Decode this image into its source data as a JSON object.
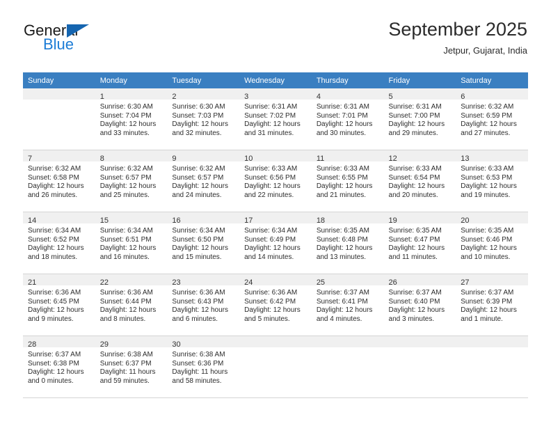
{
  "brand": {
    "word1": "General",
    "word2": "Blue",
    "triangle_color": "#1565b0",
    "blue_text_color": "#1c7cd6"
  },
  "header": {
    "title": "September 2025",
    "subtitle": "Jetpur, Gujarat, India"
  },
  "theme": {
    "header_row_bg": "#3a7fc1",
    "header_row_text": "#ffffff",
    "daynum_band_bg": "#f0f0f0",
    "grid_line": "#d4d4d4"
  },
  "calendar": {
    "weekday_headers": [
      "Sunday",
      "Monday",
      "Tuesday",
      "Wednesday",
      "Thursday",
      "Friday",
      "Saturday"
    ],
    "weeks": [
      [
        {
          "day": "",
          "sunrise": "",
          "sunset": "",
          "daylight": "",
          "empty": true
        },
        {
          "day": "1",
          "sunrise": "Sunrise: 6:30 AM",
          "sunset": "Sunset: 7:04 PM",
          "daylight": "Daylight: 12 hours and 33 minutes."
        },
        {
          "day": "2",
          "sunrise": "Sunrise: 6:30 AM",
          "sunset": "Sunset: 7:03 PM",
          "daylight": "Daylight: 12 hours and 32 minutes."
        },
        {
          "day": "3",
          "sunrise": "Sunrise: 6:31 AM",
          "sunset": "Sunset: 7:02 PM",
          "daylight": "Daylight: 12 hours and 31 minutes."
        },
        {
          "day": "4",
          "sunrise": "Sunrise: 6:31 AM",
          "sunset": "Sunset: 7:01 PM",
          "daylight": "Daylight: 12 hours and 30 minutes."
        },
        {
          "day": "5",
          "sunrise": "Sunrise: 6:31 AM",
          "sunset": "Sunset: 7:00 PM",
          "daylight": "Daylight: 12 hours and 29 minutes."
        },
        {
          "day": "6",
          "sunrise": "Sunrise: 6:32 AM",
          "sunset": "Sunset: 6:59 PM",
          "daylight": "Daylight: 12 hours and 27 minutes."
        }
      ],
      [
        {
          "day": "7",
          "sunrise": "Sunrise: 6:32 AM",
          "sunset": "Sunset: 6:58 PM",
          "daylight": "Daylight: 12 hours and 26 minutes."
        },
        {
          "day": "8",
          "sunrise": "Sunrise: 6:32 AM",
          "sunset": "Sunset: 6:57 PM",
          "daylight": "Daylight: 12 hours and 25 minutes."
        },
        {
          "day": "9",
          "sunrise": "Sunrise: 6:32 AM",
          "sunset": "Sunset: 6:57 PM",
          "daylight": "Daylight: 12 hours and 24 minutes."
        },
        {
          "day": "10",
          "sunrise": "Sunrise: 6:33 AM",
          "sunset": "Sunset: 6:56 PM",
          "daylight": "Daylight: 12 hours and 22 minutes."
        },
        {
          "day": "11",
          "sunrise": "Sunrise: 6:33 AM",
          "sunset": "Sunset: 6:55 PM",
          "daylight": "Daylight: 12 hours and 21 minutes."
        },
        {
          "day": "12",
          "sunrise": "Sunrise: 6:33 AM",
          "sunset": "Sunset: 6:54 PM",
          "daylight": "Daylight: 12 hours and 20 minutes."
        },
        {
          "day": "13",
          "sunrise": "Sunrise: 6:33 AM",
          "sunset": "Sunset: 6:53 PM",
          "daylight": "Daylight: 12 hours and 19 minutes."
        }
      ],
      [
        {
          "day": "14",
          "sunrise": "Sunrise: 6:34 AM",
          "sunset": "Sunset: 6:52 PM",
          "daylight": "Daylight: 12 hours and 18 minutes."
        },
        {
          "day": "15",
          "sunrise": "Sunrise: 6:34 AM",
          "sunset": "Sunset: 6:51 PM",
          "daylight": "Daylight: 12 hours and 16 minutes."
        },
        {
          "day": "16",
          "sunrise": "Sunrise: 6:34 AM",
          "sunset": "Sunset: 6:50 PM",
          "daylight": "Daylight: 12 hours and 15 minutes."
        },
        {
          "day": "17",
          "sunrise": "Sunrise: 6:34 AM",
          "sunset": "Sunset: 6:49 PM",
          "daylight": "Daylight: 12 hours and 14 minutes."
        },
        {
          "day": "18",
          "sunrise": "Sunrise: 6:35 AM",
          "sunset": "Sunset: 6:48 PM",
          "daylight": "Daylight: 12 hours and 13 minutes."
        },
        {
          "day": "19",
          "sunrise": "Sunrise: 6:35 AM",
          "sunset": "Sunset: 6:47 PM",
          "daylight": "Daylight: 12 hours and 11 minutes."
        },
        {
          "day": "20",
          "sunrise": "Sunrise: 6:35 AM",
          "sunset": "Sunset: 6:46 PM",
          "daylight": "Daylight: 12 hours and 10 minutes."
        }
      ],
      [
        {
          "day": "21",
          "sunrise": "Sunrise: 6:36 AM",
          "sunset": "Sunset: 6:45 PM",
          "daylight": "Daylight: 12 hours and 9 minutes."
        },
        {
          "day": "22",
          "sunrise": "Sunrise: 6:36 AM",
          "sunset": "Sunset: 6:44 PM",
          "daylight": "Daylight: 12 hours and 8 minutes."
        },
        {
          "day": "23",
          "sunrise": "Sunrise: 6:36 AM",
          "sunset": "Sunset: 6:43 PM",
          "daylight": "Daylight: 12 hours and 6 minutes."
        },
        {
          "day": "24",
          "sunrise": "Sunrise: 6:36 AM",
          "sunset": "Sunset: 6:42 PM",
          "daylight": "Daylight: 12 hours and 5 minutes."
        },
        {
          "day": "25",
          "sunrise": "Sunrise: 6:37 AM",
          "sunset": "Sunset: 6:41 PM",
          "daylight": "Daylight: 12 hours and 4 minutes."
        },
        {
          "day": "26",
          "sunrise": "Sunrise: 6:37 AM",
          "sunset": "Sunset: 6:40 PM",
          "daylight": "Daylight: 12 hours and 3 minutes."
        },
        {
          "day": "27",
          "sunrise": "Sunrise: 6:37 AM",
          "sunset": "Sunset: 6:39 PM",
          "daylight": "Daylight: 12 hours and 1 minute."
        }
      ],
      [
        {
          "day": "28",
          "sunrise": "Sunrise: 6:37 AM",
          "sunset": "Sunset: 6:38 PM",
          "daylight": "Daylight: 12 hours and 0 minutes."
        },
        {
          "day": "29",
          "sunrise": "Sunrise: 6:38 AM",
          "sunset": "Sunset: 6:37 PM",
          "daylight": "Daylight: 11 hours and 59 minutes."
        },
        {
          "day": "30",
          "sunrise": "Sunrise: 6:38 AM",
          "sunset": "Sunset: 6:36 PM",
          "daylight": "Daylight: 11 hours and 58 minutes."
        },
        {
          "day": "",
          "sunrise": "",
          "sunset": "",
          "daylight": "",
          "empty": true
        },
        {
          "day": "",
          "sunrise": "",
          "sunset": "",
          "daylight": "",
          "empty": true
        },
        {
          "day": "",
          "sunrise": "",
          "sunset": "",
          "daylight": "",
          "empty": true
        },
        {
          "day": "",
          "sunrise": "",
          "sunset": "",
          "daylight": "",
          "empty": true
        }
      ]
    ]
  }
}
